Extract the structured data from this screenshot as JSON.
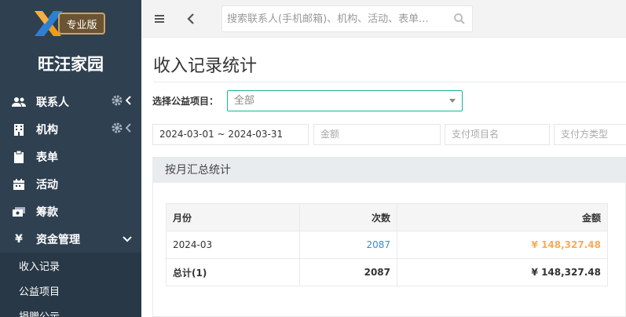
{
  "brand": {
    "badge": "专业版",
    "site_name": "旺汪家园"
  },
  "sidebar": {
    "items": [
      {
        "label": "联系人",
        "icon": "users-icon",
        "gear": true,
        "chevron": "left"
      },
      {
        "label": "机构",
        "icon": "building-icon",
        "gear": true,
        "chevron": "left"
      },
      {
        "label": "表单",
        "icon": "clipboard-icon",
        "gear": false,
        "chevron": ""
      },
      {
        "label": "活动",
        "icon": "calendar-icon",
        "gear": false,
        "chevron": ""
      },
      {
        "label": "筹款",
        "icon": "money-icon",
        "gear": false,
        "chevron": ""
      },
      {
        "label": "资金管理",
        "icon": "yen-icon",
        "gear": false,
        "chevron": "down"
      }
    ],
    "sub_items": [
      "收入记录",
      "公益项目",
      "捐赠公示"
    ]
  },
  "topbar": {
    "search_placeholder": "搜索联系人(手机邮箱)、机构、活动、表单..."
  },
  "page": {
    "title": "收入记录统计",
    "project_label": "选择公益项目：",
    "project_value": "全部",
    "date_range": "2024-03-01 ~ 2024-03-31",
    "amount_placeholder": "金额",
    "pay_item_placeholder": "支付项目名",
    "pay_type_placeholder": "支付方类型"
  },
  "summary": {
    "title": "按月汇总统计",
    "headers": [
      "月份",
      "次数",
      "金额"
    ],
    "rows": [
      {
        "month": "2024-03",
        "count": "2087",
        "amount": "¥ 148,327.48"
      }
    ],
    "total": {
      "label": "总计(1)",
      "count": "2087",
      "amount": "¥ 148,327.48"
    }
  },
  "colors": {
    "sidebar_bg": "#2f4050",
    "accent_green": "#1ab394",
    "link_blue": "#3b8bd4",
    "amount_orange": "#f8ac59",
    "badge_gold": "#c9a46a"
  }
}
